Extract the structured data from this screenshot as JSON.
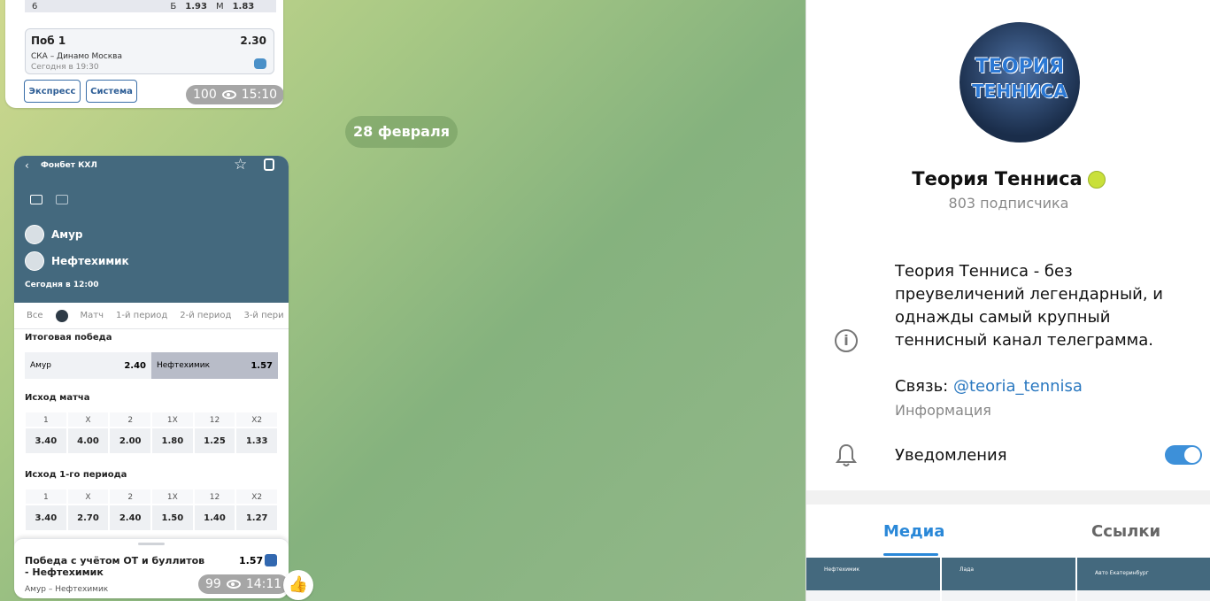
{
  "chat": {
    "date_separator": "28 февраля",
    "bubble1": {
      "top_row": {
        "num": "6",
        "b": "Б",
        "b_val": "1.93",
        "m": "М",
        "m_val": "1.83"
      },
      "bet_card": {
        "title": "Поб 1",
        "odds": "2.30",
        "match": "СКА – Динамо Москва",
        "when": "Сегодня в 19:30"
      },
      "buttons": [
        "Экспресс",
        "Система"
      ],
      "views": "100",
      "time": "15:10"
    },
    "bubble2": {
      "app_title": "Фонбет КХЛ",
      "team1": "Амур",
      "team2": "Нефтехимик",
      "when": "Сегодня в 12:00",
      "tabs": [
        "Все",
        "Матч",
        "1-й период",
        "2-й период",
        "3-й пери"
      ],
      "sections": {
        "final_win": "Итоговая победа",
        "match_outcome": "Исход матча",
        "period1_outcome": "Исход 1-го периода"
      },
      "final_win": [
        {
          "team": "Амур",
          "odds": "2.40"
        },
        {
          "team": "Нефтехимик",
          "odds": "1.57"
        }
      ],
      "outcome_headers": [
        "1",
        "X",
        "2",
        "1X",
        "12",
        "X2"
      ],
      "match_outcome_values": [
        "3.40",
        "4.00",
        "2.00",
        "1.80",
        "1.25",
        "1.33"
      ],
      "period1_values": [
        "3.40",
        "2.70",
        "2.40",
        "1.50",
        "1.40",
        "1.27"
      ],
      "sheet": {
        "title": "Победа с учётом ОТ и буллитов - Нефтехимик",
        "odds": "1.57",
        "match": "Амур – Нефтехимик"
      },
      "views": "99",
      "time": "14:11",
      "reaction": "👍"
    }
  },
  "panel": {
    "avatar_text": [
      "ТЕОРИЯ",
      "ТЕННИСА"
    ],
    "channel_name": "Теория Тенниса",
    "subscribers": "803 подписчика",
    "description": "Теория Тенниса - без преувеличений легендарный, и однажды самый крупный теннисный канал телеграмма.",
    "contact_prefix": "Связь: ",
    "contact_handle": "@teoria_tennisa",
    "info_label": "Информация",
    "notifications_label": "Уведомления",
    "notifications_on": true,
    "tabs": [
      "Медиа",
      "Ссылки"
    ],
    "thumbs": [
      "Нефтехимик",
      "Лада",
      "Авто Екатеринбург"
    ],
    "accent_color": "#3d90d9"
  }
}
